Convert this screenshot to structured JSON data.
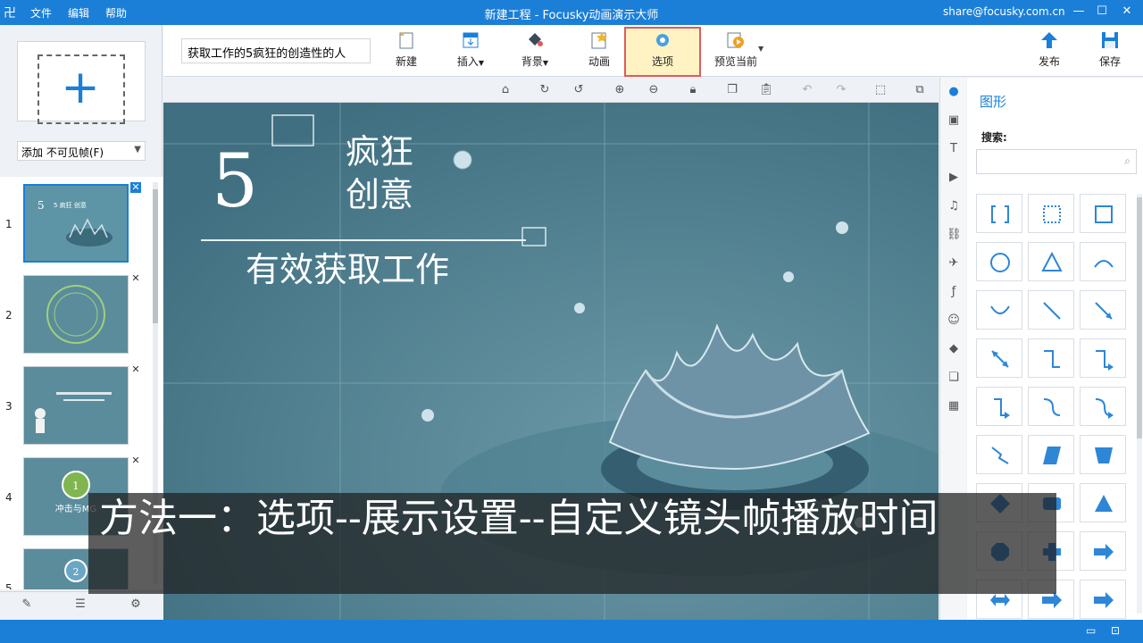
{
  "titlebar": {
    "logo": "卍",
    "menus": [
      "文件",
      "编辑",
      "帮助"
    ],
    "title": "新建工程 - Focusky动画演示大师",
    "email": "share@focusky.com.cn",
    "min": "—",
    "max": "☐",
    "close": "✕"
  },
  "left": {
    "add_plus": "+",
    "add_select": "添加 不可见帧(F)",
    "thumbs": [
      {
        "num": "1",
        "text": "5 疯狂 创意"
      },
      {
        "num": "2",
        "text": ""
      },
      {
        "num": "3",
        "text": ""
      },
      {
        "num": "4",
        "text": "冲击与MG"
      },
      {
        "num": "5",
        "text": ""
      }
    ]
  },
  "toolbar": {
    "project_title": "获取工作的5疯狂的创造性的人",
    "new": "新建",
    "insert": "插入",
    "background": "背景",
    "animation": "动画",
    "options": "选项",
    "preview": "预览当前",
    "publish": "发布",
    "save": "保存"
  },
  "canvas": {
    "big_number": "5",
    "title_line1": "疯狂",
    "title_line2": "创意",
    "subtitle": "有效获取工作"
  },
  "right_panel": {
    "title": "图形",
    "search_label": "搜索:",
    "search_placeholder": ""
  },
  "caption": "方法一：选项--展示设置--自定义镜头帧播放时间",
  "colors": {
    "accent": "#1b7fd8",
    "canvas_bg": "#4f7f8f",
    "highlight_border": "#e05a5a",
    "shape_blue": "#2e86d6"
  }
}
